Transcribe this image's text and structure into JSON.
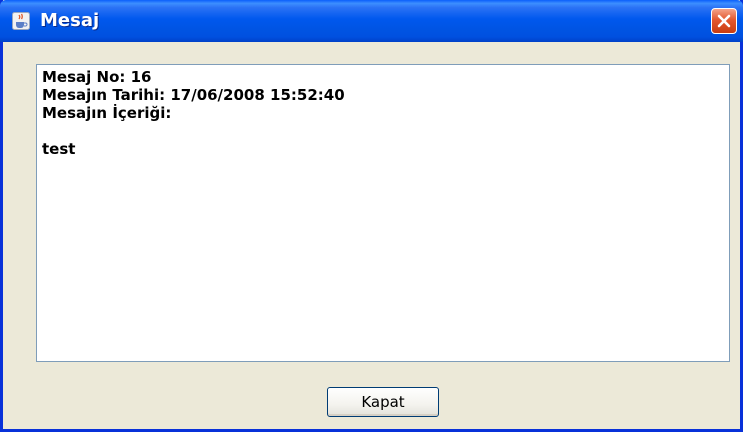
{
  "window": {
    "title": "Mesaj",
    "title_icon": "java-cup-icon",
    "close_icon": "close-icon"
  },
  "message": {
    "number_line": "Mesaj No: 16",
    "date_line": "Mesajın Tarihi: 17/06/2008 15:52:40",
    "content_label": "Mesajın İçeriği:",
    "body": "test"
  },
  "buttons": {
    "close_label": "Kapat"
  },
  "colors": {
    "titlebar": "#0054e3",
    "window_frame": "#0831d9",
    "dialog_background": "#ece9d8",
    "close_button": "#e3582f",
    "content_border": "#7f9db9"
  }
}
